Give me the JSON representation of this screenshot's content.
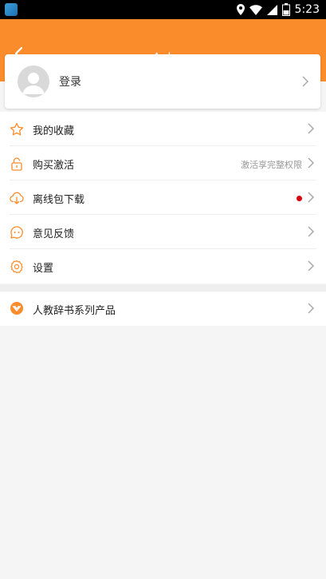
{
  "status_bar": {
    "time": "5:23",
    "battery": "8"
  },
  "header": {
    "title": "个人"
  },
  "login": {
    "label": "登录"
  },
  "menu": [
    {
      "label": "我的收藏",
      "icon": "star-icon"
    },
    {
      "label": "购买激活",
      "icon": "lock-icon",
      "note": "激活享完整权限"
    },
    {
      "label": "离线包下载",
      "icon": "download-icon",
      "badge": "red-dot"
    },
    {
      "label": "意见反馈",
      "icon": "feedback-icon"
    },
    {
      "label": "设置",
      "icon": "settings-icon"
    }
  ],
  "products": {
    "label": "人教辞书系列产品",
    "icon": "product-logo-icon"
  },
  "colors": {
    "accent": "#fb8c2b",
    "badge": "#d9000d"
  }
}
